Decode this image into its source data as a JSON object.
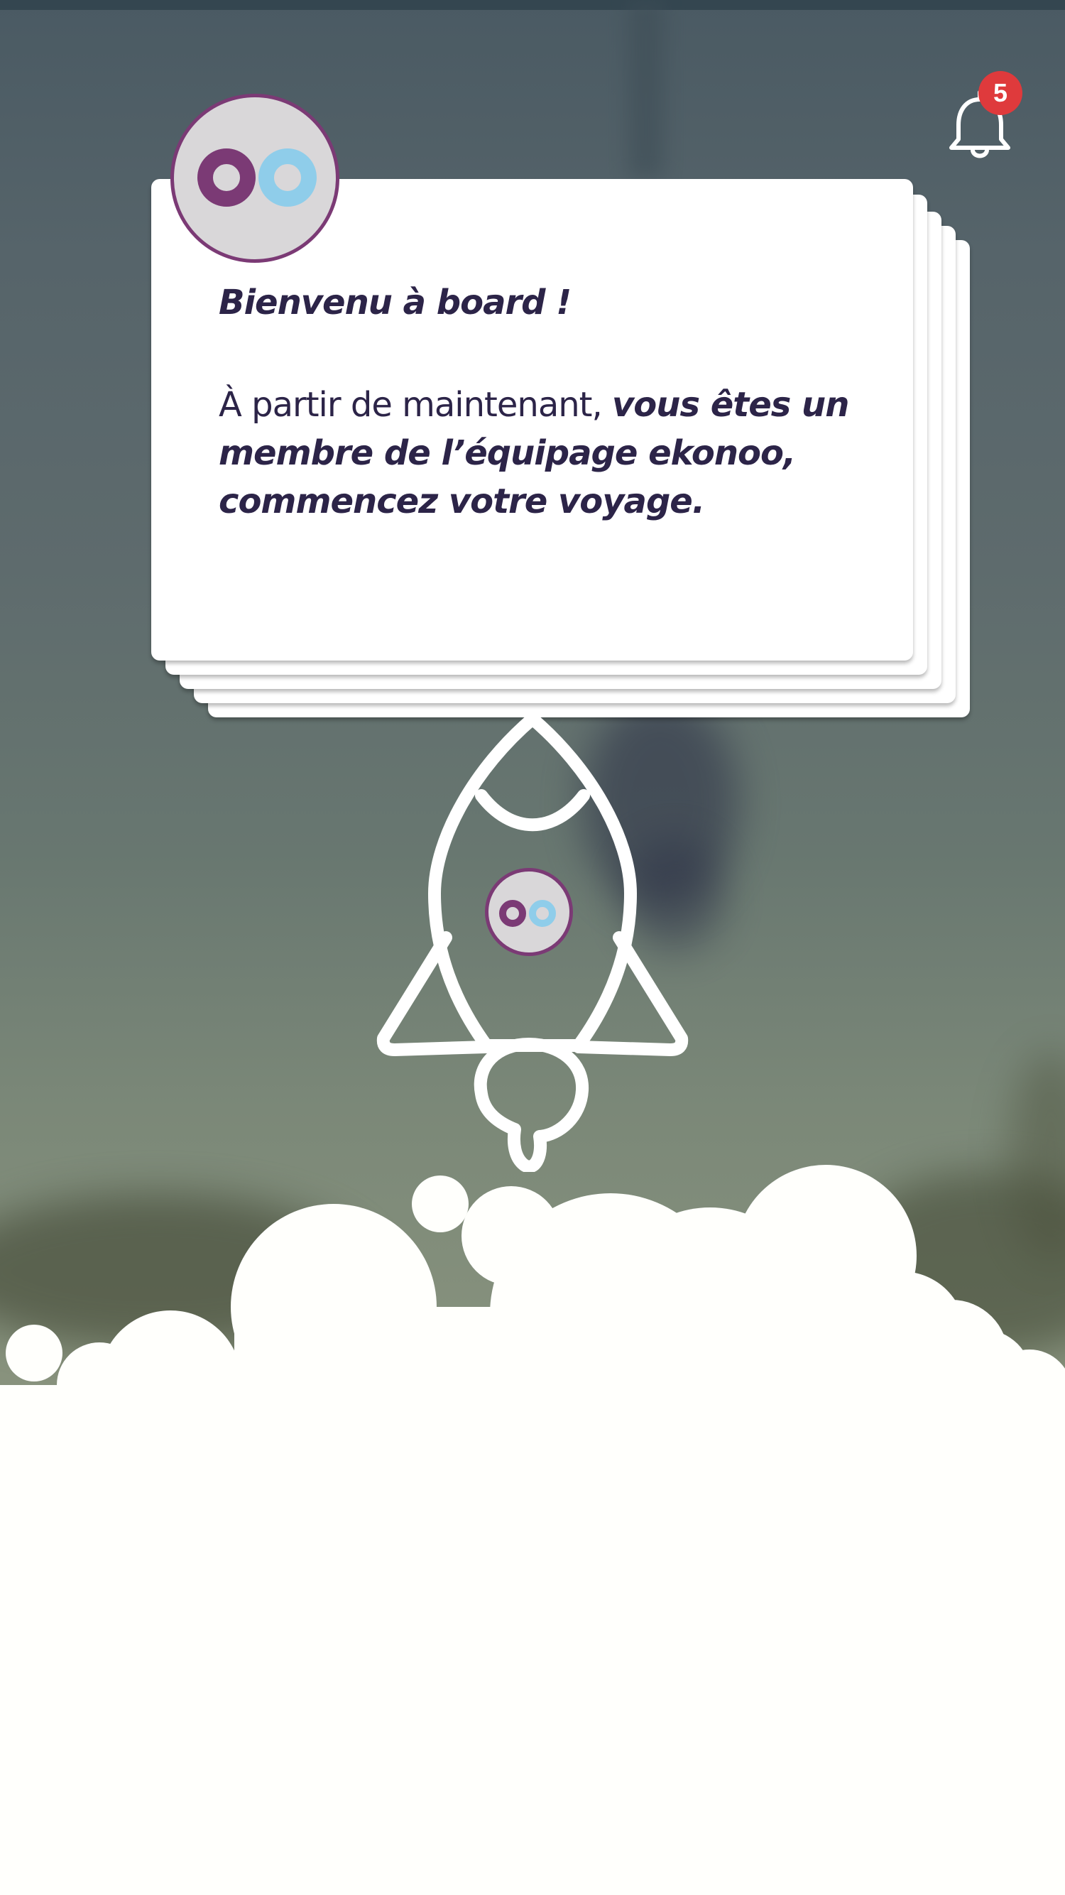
{
  "notifications": {
    "count": "5",
    "bell_icon": "bell-icon"
  },
  "welcome_card": {
    "title": "Bienvenu à board !",
    "body_plain": "À partir de maintenant, ",
    "body_strong": "vous êtes un membre de l’équipage ekonoo, commencez votre voyage."
  },
  "brand": {
    "logo_icon": "ekonoo-oo-logo",
    "purple": "#7b3a75",
    "light_blue": "#8fcdea",
    "badge_red": "#df3a3c",
    "text_dark": "#2c2448"
  },
  "illustration": {
    "icon": "rocket-icon",
    "clouds": "clouds-illustration"
  }
}
